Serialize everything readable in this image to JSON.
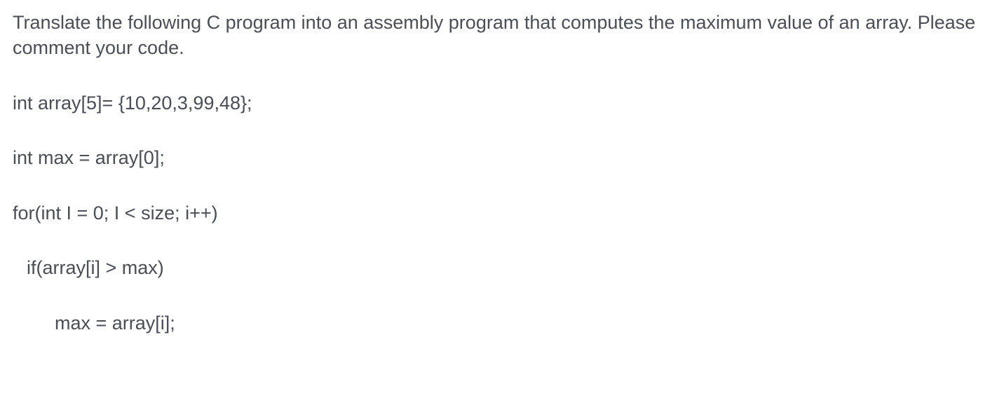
{
  "question": {
    "prompt": "Translate the following C program into an assembly program that computes the maximum value of an array. Please comment your code."
  },
  "code": {
    "line1": "int array[5]= {10,20,3,99,48};",
    "line2": "int max = array[0];",
    "line3": "for(int I = 0; I < size; i++)",
    "line4": "if(array[i] > max)",
    "line5": "max = array[i];"
  }
}
